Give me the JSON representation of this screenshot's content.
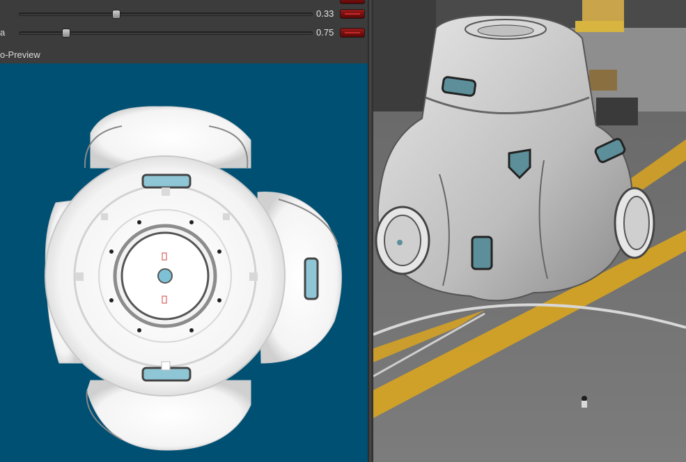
{
  "inspector": {
    "rows": [
      {
        "label": "",
        "value": "0.33",
        "slider_fraction": 0.33
      },
      {
        "label": "a",
        "value": "0.75",
        "slider_fraction": 0.16
      }
    ],
    "preview_title": "o-Preview"
  },
  "colors": {
    "panel_bg": "#3c3c3c",
    "preview_bg": "#005074",
    "swatch_red": "#8b1414",
    "floor_yellow": "#d9a520"
  }
}
